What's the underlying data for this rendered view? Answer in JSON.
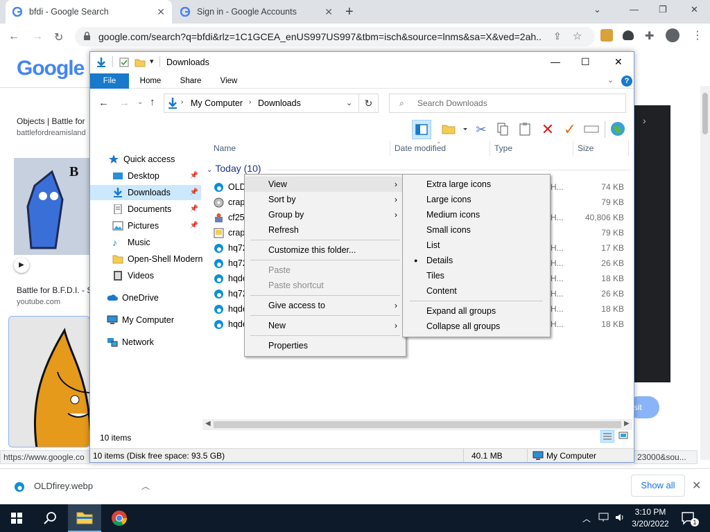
{
  "browser": {
    "tabs": [
      {
        "title": "bfdi - Google Search",
        "active": true
      },
      {
        "title": "Sign in - Google Accounts",
        "active": false
      }
    ],
    "url": "google.com/search?q=bfdi&rlz=1C1GCEA_enUS997US997&tbm=isch&source=lnms&sa=X&ved=2ah...",
    "status_url": "https://www.google.co",
    "status_url_tail": "23000&sou..."
  },
  "google": {
    "logo": "Google",
    "result1_title": "Objects | Battle for",
    "result1_source": "battlefordreamisland",
    "result2_title": "Battle for B.F.D.I. - S",
    "result2_source": "youtube.com",
    "visit_label": "isit"
  },
  "explorer": {
    "title": "Downloads",
    "ribbon_tabs": [
      "File",
      "Home",
      "Share",
      "View"
    ],
    "breadcrumb": [
      "My Computer",
      "Downloads"
    ],
    "search_placeholder": "Search Downloads",
    "nav": [
      {
        "label": "Quick access",
        "icon": "star-icon",
        "pinned": false
      },
      {
        "label": "Desktop",
        "icon": "desktop-icon",
        "pinned": true
      },
      {
        "label": "Downloads",
        "icon": "download-arrow-icon",
        "pinned": true,
        "selected": true
      },
      {
        "label": "Documents",
        "icon": "documents-icon",
        "pinned": true
      },
      {
        "label": "Pictures",
        "icon": "pictures-icon",
        "pinned": true
      },
      {
        "label": "Music",
        "icon": "music-note-icon",
        "pinned": false
      },
      {
        "label": "Open-Shell Modern",
        "icon": "folder-icon",
        "pinned": false
      },
      {
        "label": "Videos",
        "icon": "videos-icon",
        "pinned": false
      },
      {
        "label": "OneDrive",
        "icon": "cloud-icon",
        "pinned": false
      },
      {
        "label": "My Computer",
        "icon": "computer-icon",
        "pinned": false
      },
      {
        "label": "Network",
        "icon": "network-icon",
        "pinned": false
      }
    ],
    "columns": [
      "Name",
      "Date modified",
      "Type",
      "Size"
    ],
    "group": "Today (10)",
    "files": [
      {
        "name": "OLD",
        "icon": "edge-icon",
        "type": "H...",
        "size": "74 KB"
      },
      {
        "name": "crap",
        "icon": "disc-icon",
        "type": "",
        "size": "79 KB"
      },
      {
        "name": "cf25",
        "icon": "installer-icon",
        "type": "H...",
        "size": "40,806 KB"
      },
      {
        "name": "crap",
        "icon": "ini-file-icon",
        "type": "",
        "size": "79 KB"
      },
      {
        "name": "hq72",
        "icon": "edge-icon",
        "type": "H...",
        "size": "17 KB"
      },
      {
        "name": "hq72",
        "icon": "edge-icon",
        "type": "H...",
        "size": "26 KB"
      },
      {
        "name": "hqde",
        "icon": "edge-icon",
        "type": "H...",
        "size": "18 KB"
      },
      {
        "name": "hq72",
        "icon": "edge-icon",
        "type": "H...",
        "size": "26 KB"
      },
      {
        "name": "hqde",
        "icon": "edge-icon",
        "type": "H...",
        "size": "18 KB"
      },
      {
        "name": "hqde",
        "icon": "edge-icon",
        "type": "H...",
        "size": "18 KB"
      }
    ],
    "items_count": "10 items",
    "status_left": "10 items (Disk free space: 93.5 GB)",
    "status_size": "40.1 MB",
    "status_location": "My Computer"
  },
  "context_menu": {
    "items": [
      {
        "label": "View",
        "submenu": true,
        "highlighted": true
      },
      {
        "label": "Sort by",
        "submenu": true
      },
      {
        "label": "Group by",
        "submenu": true
      },
      {
        "label": "Refresh"
      },
      {
        "label": "Customize this folder..."
      },
      {
        "label": "Paste",
        "disabled": true
      },
      {
        "label": "Paste shortcut",
        "disabled": true
      },
      {
        "label": "Give access to",
        "submenu": true
      },
      {
        "label": "New",
        "submenu": true
      },
      {
        "label": "Properties"
      }
    ]
  },
  "view_submenu": {
    "items": [
      {
        "label": "Extra large icons"
      },
      {
        "label": "Large icons"
      },
      {
        "label": "Medium icons"
      },
      {
        "label": "Small icons"
      },
      {
        "label": "List"
      },
      {
        "label": "Details",
        "checked": true
      },
      {
        "label": "Tiles"
      },
      {
        "label": "Content"
      },
      {
        "label": "Expand all groups"
      },
      {
        "label": "Collapse all groups"
      }
    ]
  },
  "download_bar": {
    "file": "OLDfirey.webp",
    "show_all": "Show all"
  },
  "taskbar": {
    "time": "3:10 PM",
    "date": "3/20/2022",
    "notification_count": "1"
  },
  "colors": {
    "accent_blue": "#1979ca",
    "selection": "#cce8ff",
    "taskbar": "#0c1a2a",
    "google_blue": "#1a73e8"
  }
}
